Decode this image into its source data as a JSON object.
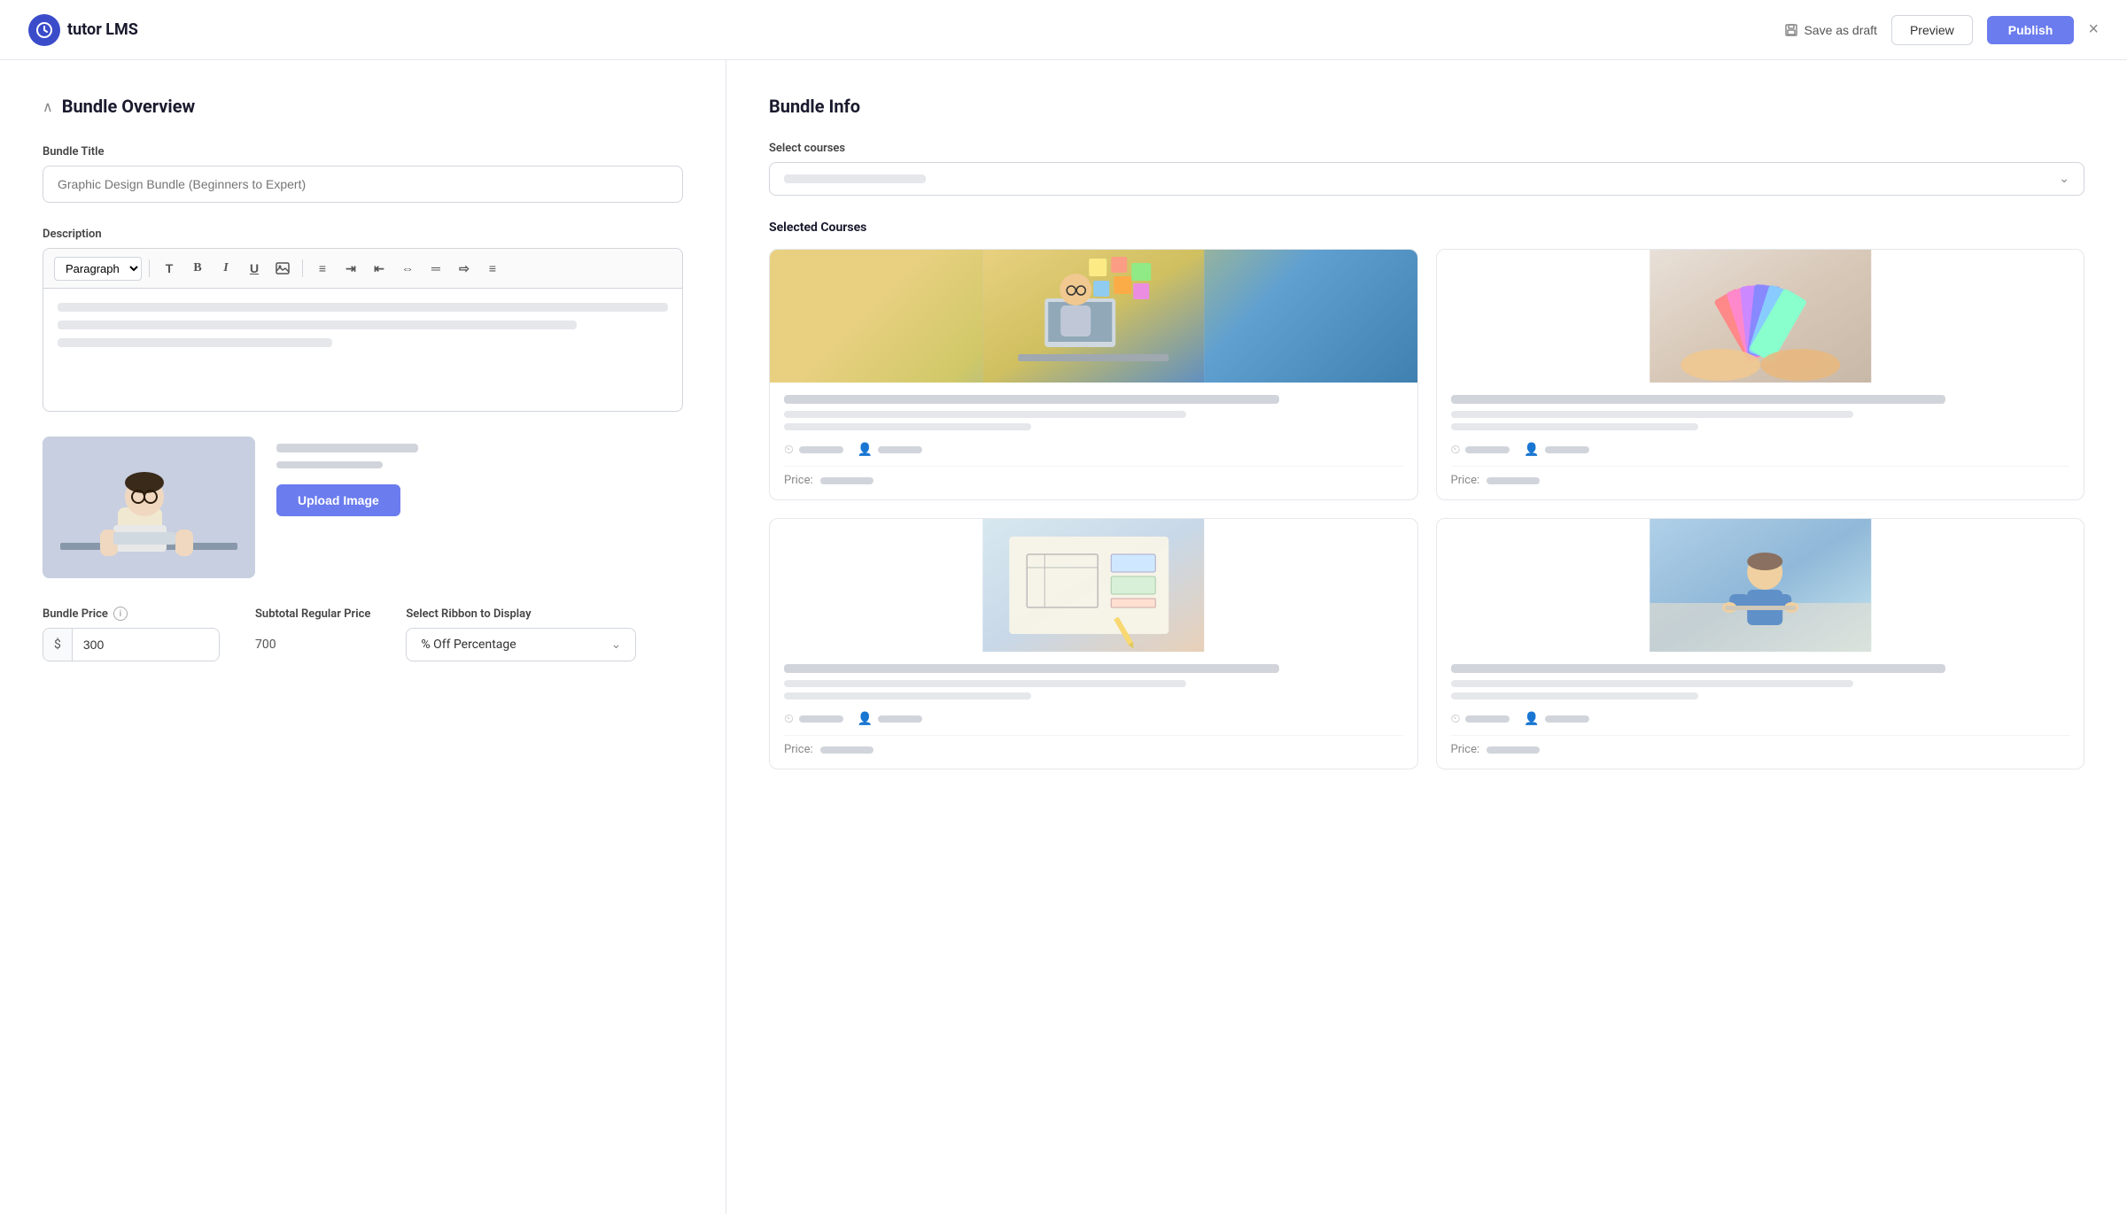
{
  "app": {
    "logo_text": "tutor LMS",
    "logo_icon": "⏱"
  },
  "navbar": {
    "save_draft_label": "Save as draft",
    "preview_label": "Preview",
    "publish_label": "Publish",
    "close_label": "×"
  },
  "left_panel": {
    "section_title": "Bundle Overview",
    "bundle_title_label": "Bundle Title",
    "bundle_title_placeholder": "Graphic Design Bundle (Beginners to Expert)",
    "description_label": "Description",
    "toolbar": {
      "paragraph_label": "Paragraph",
      "bold": "B",
      "italic": "I",
      "underline": "U"
    },
    "upload": {
      "button_label": "Upload Image"
    },
    "bundle_price_label": "Bundle Price",
    "bundle_price_currency": "$",
    "bundle_price_value": "300",
    "subtotal_label": "Subtotal Regular Price",
    "subtotal_value": "700",
    "ribbon_label": "Select Ribbon to Display",
    "ribbon_value": "% Off Percentage"
  },
  "right_panel": {
    "section_title": "Bundle Info",
    "select_courses_label": "Select courses",
    "selected_courses_title": "Selected Courses",
    "price_label": "Price:",
    "courses": [
      {
        "id": "course-1",
        "image_class": "course-img-1",
        "alt": "Person at computer with sticky notes"
      },
      {
        "id": "course-2",
        "image_class": "course-img-2",
        "alt": "Color swatches held by hands"
      },
      {
        "id": "course-3",
        "image_class": "course-img-3",
        "alt": "Design sketching on paper"
      },
      {
        "id": "course-4",
        "image_class": "course-img-4",
        "alt": "Person at desk working"
      }
    ]
  }
}
